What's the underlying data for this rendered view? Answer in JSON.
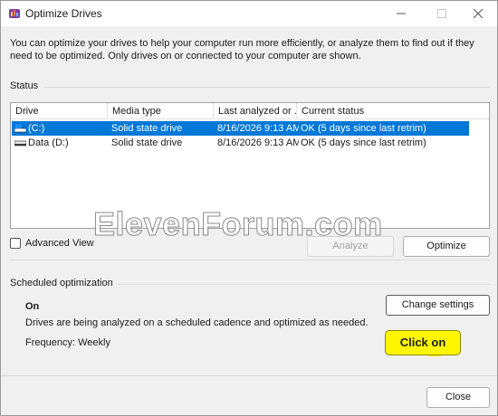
{
  "window": {
    "title": "Optimize Drives",
    "minimize_icon": "minimize-icon",
    "maximize_icon": "maximize-icon",
    "close_icon": "close-icon"
  },
  "intro_text": "You can optimize your drives to help your computer run more efficiently, or analyze them to find out if they need to be optimized. Only drives on or connected to your computer are shown.",
  "status": {
    "label": "Status",
    "columns": [
      "Drive",
      "Media type",
      "Last analyzed or ...",
      "Current status"
    ],
    "rows": [
      {
        "drive": "(C:)",
        "media": "Solid state drive",
        "last": "8/16/2026 9:13 AM",
        "status": "OK (5 days since last retrim)",
        "selected": true
      },
      {
        "drive": "Data (D:)",
        "media": "Solid state drive",
        "last": "8/16/2026 9:13 AM",
        "status": "OK (5 days since last retrim)",
        "selected": false
      }
    ]
  },
  "advanced_view": {
    "label": "Advanced View",
    "checked": false
  },
  "buttons": {
    "analyze": "Analyze",
    "optimize": "Optimize",
    "change_settings": "Change settings",
    "close": "Close"
  },
  "scheduled": {
    "label": "Scheduled optimization",
    "state": "On",
    "description": "Drives are being analyzed on a scheduled cadence and optimized as needed.",
    "frequency": "Frequency: Weekly"
  },
  "callout_text": "Click on",
  "watermark_text": "ElevenForum.com",
  "colors": {
    "selection": "#0078d7",
    "callout": "#fff600"
  }
}
